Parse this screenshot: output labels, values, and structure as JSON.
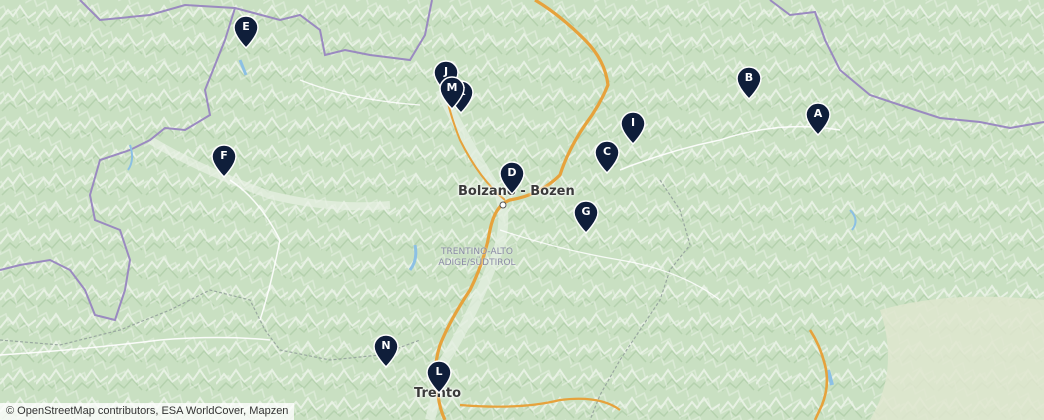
{
  "map": {
    "cities": [
      {
        "id": "bolzano",
        "name": "Bolzano - Bozen"
      },
      {
        "id": "trento",
        "name": "Trento"
      }
    ],
    "region_label": [
      "TRENTINO-ALTO",
      "ADIGE/SÜDTIROL"
    ],
    "markers": [
      {
        "id": "E",
        "label": "E"
      },
      {
        "id": "J",
        "label": "J"
      },
      {
        "id": "K",
        "label": "K"
      },
      {
        "id": "M",
        "label": "M"
      },
      {
        "id": "B",
        "label": "B"
      },
      {
        "id": "A",
        "label": "A"
      },
      {
        "id": "I",
        "label": "I"
      },
      {
        "id": "C",
        "label": "C"
      },
      {
        "id": "F",
        "label": "F"
      },
      {
        "id": "D",
        "label": "D"
      },
      {
        "id": "G",
        "label": "G"
      },
      {
        "id": "N",
        "label": "N"
      },
      {
        "id": "L",
        "label": "L"
      }
    ],
    "marker_color": "#0f1e3a"
  },
  "attribution": "© OpenStreetMap contributors, ESA WorldCover, Mapzen"
}
